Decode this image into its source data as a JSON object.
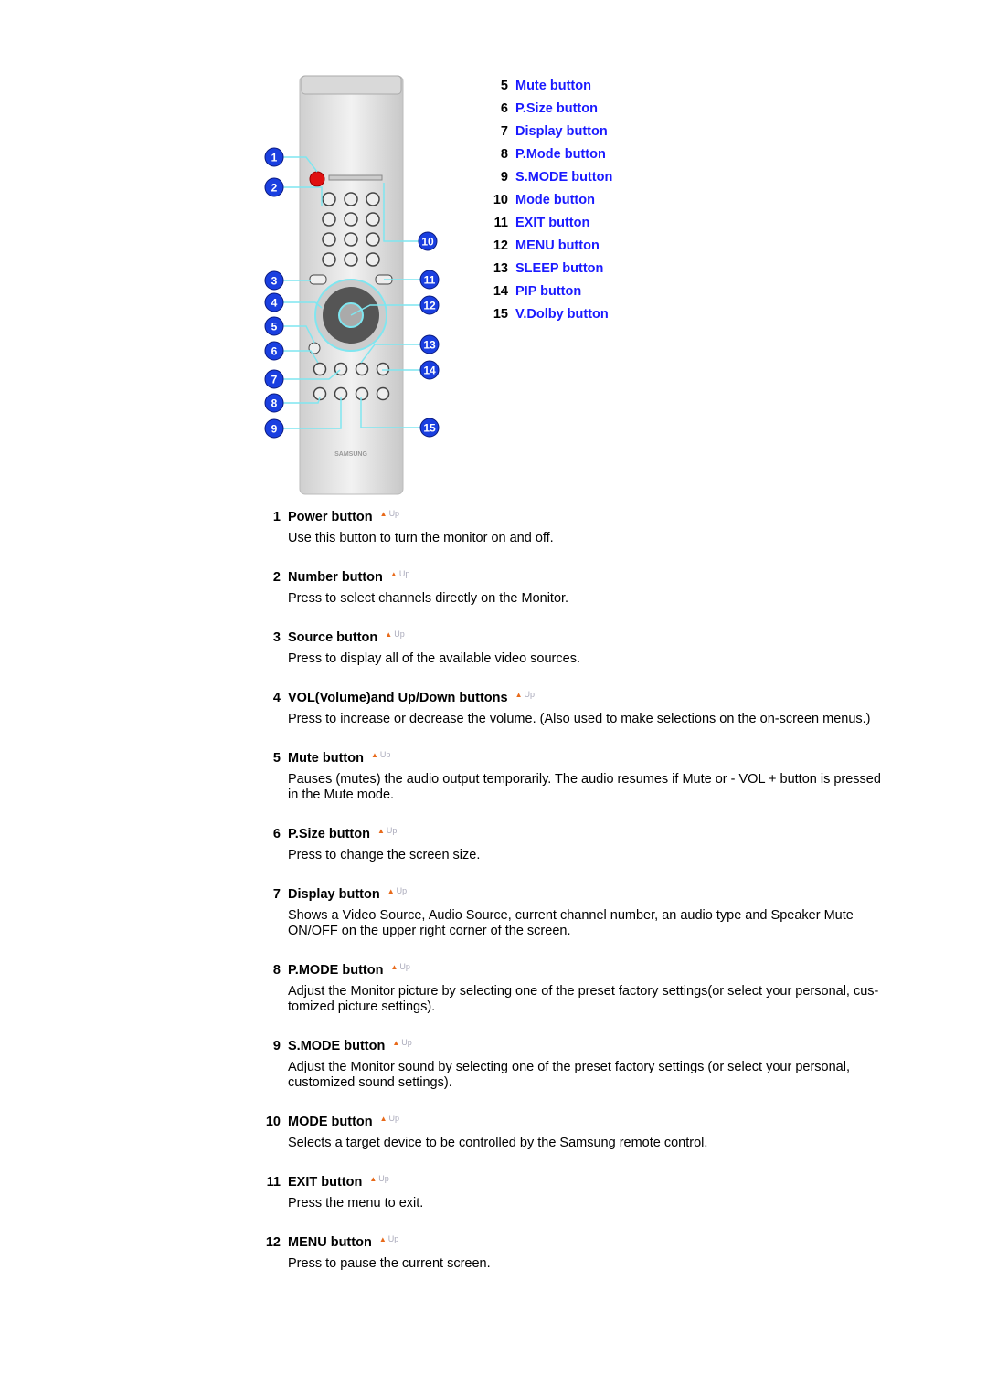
{
  "remote_image": {
    "brand": "SAMSUNG",
    "callouts": [
      "1",
      "2",
      "3",
      "4",
      "5",
      "6",
      "7",
      "8",
      "9",
      "10",
      "11",
      "12",
      "13",
      "14",
      "15"
    ],
    "accent": "#1a3fe0",
    "line_color": "#7fe6f0"
  },
  "toc": [
    {
      "num": "5",
      "label": "Mute button"
    },
    {
      "num": "6",
      "label": "P.Size button"
    },
    {
      "num": "7",
      "label": "Display button"
    },
    {
      "num": "8",
      "label": "P.Mode button"
    },
    {
      "num": "9",
      "label": "S.MODE button"
    },
    {
      "num": "10",
      "label": "Mode button"
    },
    {
      "num": "11",
      "label": "EXIT button"
    },
    {
      "num": "12",
      "label": "MENU button"
    },
    {
      "num": "13",
      "label": "SLEEP button"
    },
    {
      "num": "14",
      "label": "PIP button"
    },
    {
      "num": "15",
      "label": "V.Dolby button"
    }
  ],
  "up_label": "Up",
  "sections": [
    {
      "num": "1",
      "title": "Power button",
      "desc": "Use this button to turn the monitor on and off."
    },
    {
      "num": "2",
      "title": "Number button",
      "desc": "Press to select channels directly on the Monitor."
    },
    {
      "num": "3",
      "title": "Source button",
      "desc": "Press to display all of the available video sources."
    },
    {
      "num": "4",
      "title": "VOL(Volume)and Up/Down buttons",
      "desc": "Press to increase or decrease the volume. (Also used to make selections on the on-screen menus.)"
    },
    {
      "num": "5",
      "title": "Mute button",
      "desc": "Pauses (mutes) the audio output temporarily. The audio resumes if Mute or - VOL + button is pressed in the Mute mode."
    },
    {
      "num": "6",
      "title": "P.Size button",
      "desc": "Press to change the screen size."
    },
    {
      "num": "7",
      "title": "Display button",
      "desc": "Shows a Video Source, Audio Source, current channel number, an audio type and Speaker Mute ON/OFF on the upper right corner of the screen."
    },
    {
      "num": "8",
      "title": "P.MODE button",
      "desc": "Adjust the Monitor picture by selecting one of the preset factory settings(or select your personal, cus-tomized picture settings)."
    },
    {
      "num": "9",
      "title": "S.MODE button",
      "desc": "Adjust the Monitor sound by selecting one of the preset factory settings (or select your personal, customized sound settings)."
    },
    {
      "num": "10",
      "title": "MODE button",
      "desc": "Selects a target device to be controlled by the Samsung remote control."
    },
    {
      "num": "11",
      "title": "EXIT button",
      "desc": "Press the menu to exit."
    },
    {
      "num": "12",
      "title": "MENU button",
      "desc": "Press to pause the current screen."
    }
  ]
}
